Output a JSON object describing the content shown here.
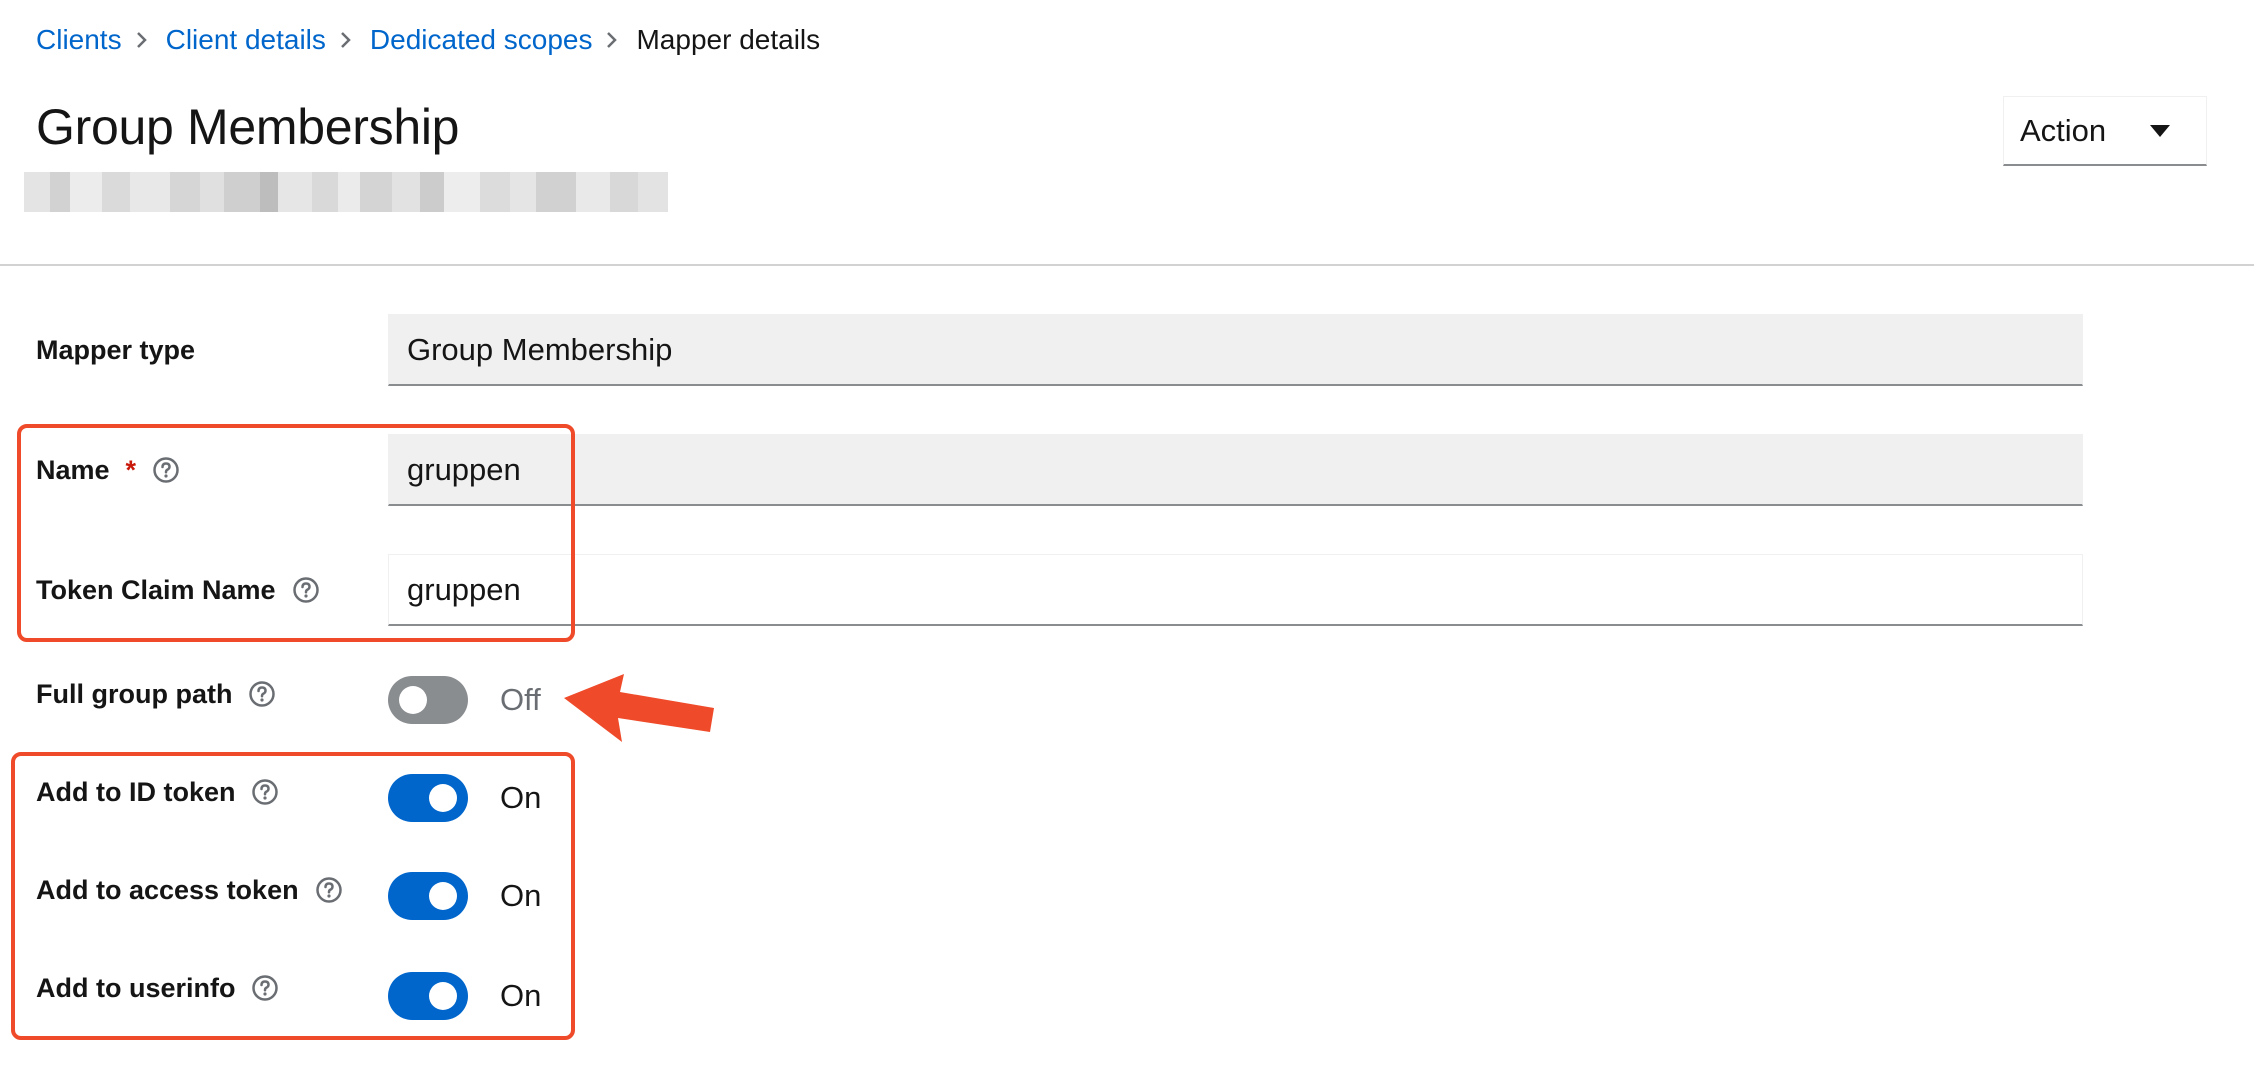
{
  "breadcrumb": {
    "items": [
      {
        "label": "Clients"
      },
      {
        "label": "Client details"
      },
      {
        "label": "Dedicated scopes"
      }
    ],
    "current": "Mapper details"
  },
  "header": {
    "title": "Group Membership",
    "action_label": "Action"
  },
  "form": {
    "mapper_type": {
      "label": "Mapper type",
      "value": "Group Membership"
    },
    "name": {
      "label": "Name",
      "required_mark": "*",
      "value": "gruppen"
    },
    "token_claim_name": {
      "label": "Token Claim Name",
      "value": "gruppen"
    },
    "full_group_path": {
      "label": "Full group path",
      "state": "Off",
      "enabled": false
    },
    "add_to_id_token": {
      "label": "Add to ID token",
      "state": "On",
      "enabled": true
    },
    "add_to_access_token": {
      "label": "Add to access token",
      "state": "On",
      "enabled": true
    },
    "add_to_userinfo": {
      "label": "Add to userinfo",
      "state": "On",
      "enabled": true
    }
  },
  "icons": {
    "breadcrumb_separator": "chevron-right-icon",
    "help": "question-circle-icon",
    "dropdown": "caret-down-icon"
  },
  "colors": {
    "link": "#0066cc",
    "switch_on": "#0066cc",
    "switch_off": "#8a8d90",
    "required": "#c9190b",
    "annotation": "#ef4b2a"
  }
}
